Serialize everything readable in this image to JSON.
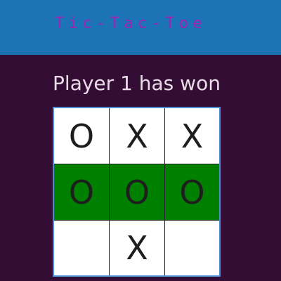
{
  "app": {
    "title": "Tic-Tac-Toe"
  },
  "game": {
    "status": "Player 1 has won",
    "board": [
      "O",
      "X",
      "X",
      "O",
      "O",
      "O",
      "",
      "X",
      ""
    ],
    "winning_cells": [
      3,
      4,
      5
    ]
  },
  "colors": {
    "header_bg": "#1c74b7",
    "page_bg": "#330d33",
    "title_text": "#9b27b0",
    "status_text": "#e8dde6",
    "cell_bg": "#ffffff",
    "win_cell_bg": "#008000",
    "board_border": "#4a8ed8"
  }
}
